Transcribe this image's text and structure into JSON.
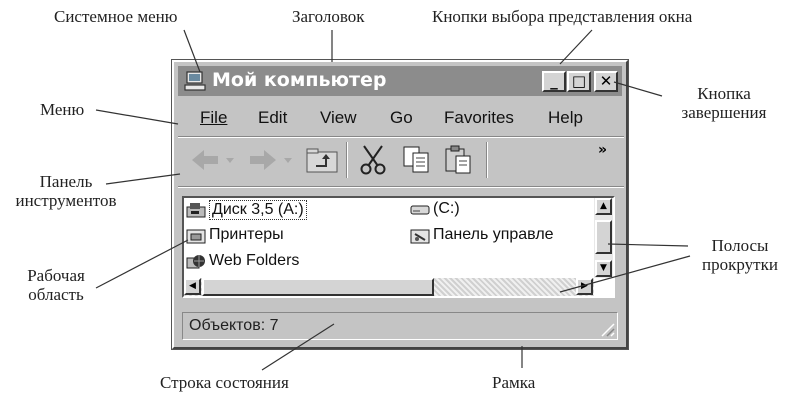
{
  "labels": {
    "system_menu": "Системное меню",
    "title": "Заголовок",
    "view_buttons": "Кнопки выбора представления окна",
    "menu": "Меню",
    "close_button": [
      "Кнопка",
      "завершения"
    ],
    "toolbar": [
      "Панель",
      "инструментов"
    ],
    "workspace": [
      "Рабочая",
      "область"
    ],
    "scrollbars": [
      "Полосы",
      "прокрутки"
    ],
    "status_bar": "Строка состояния",
    "frame": "Рамка"
  },
  "window": {
    "title": "Мой компьютер",
    "buttons": [
      "_",
      "□",
      "✕"
    ],
    "menu": [
      "File",
      "Edit",
      "View",
      "Go",
      "Favorites",
      "Help"
    ],
    "toolbar_more": "»",
    "items": [
      {
        "label": "Диск 3,5 (A:)",
        "icon": "floppy-drive-icon"
      },
      {
        "label": "(C:)",
        "icon": "hard-drive-icon"
      },
      {
        "label": "Принтеры",
        "icon": "printers-folder-icon"
      },
      {
        "label": "Панель управле",
        "icon": "control-panel-icon"
      },
      {
        "label": "Web Folders",
        "icon": "web-folders-icon"
      }
    ],
    "status": "Объектов: 7"
  },
  "colors": {
    "title_bar": "#8c8c8c",
    "window_face": "#c4c4c4"
  }
}
